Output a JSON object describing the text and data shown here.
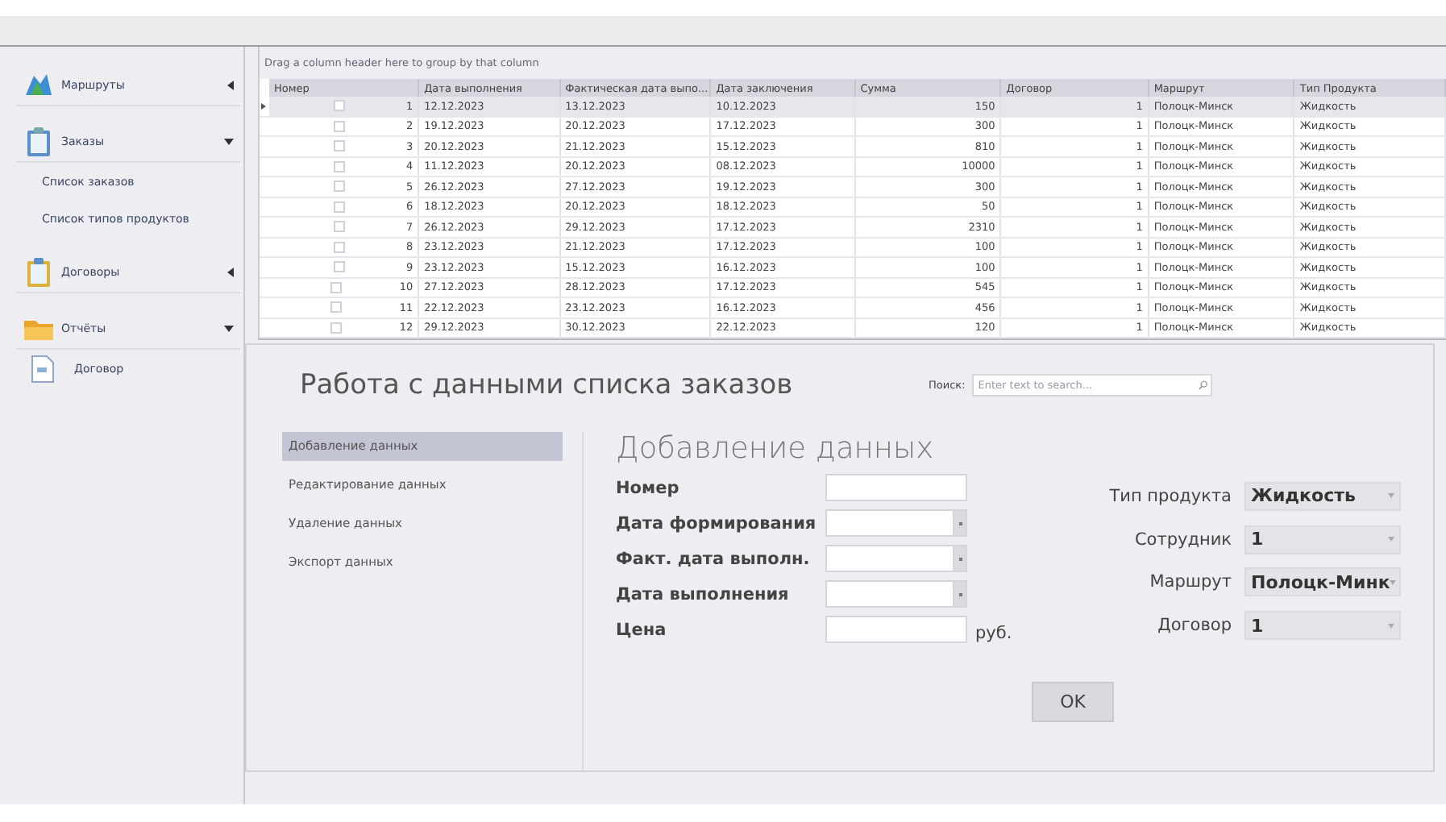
{
  "sidebar": {
    "groups": [
      {
        "label": "Маршруты",
        "expanded": false
      },
      {
        "label": "Заказы",
        "expanded": true,
        "items": [
          {
            "label": "Список заказов"
          },
          {
            "label": "Список типов продуктов"
          }
        ]
      },
      {
        "label": "Договоры",
        "expanded": false
      },
      {
        "label": "Отчёты",
        "expanded": true,
        "items": [
          {
            "label": "Договор"
          }
        ]
      }
    ]
  },
  "grid": {
    "group_hint": "Drag a column header here to group by that column",
    "columns": [
      "Номер",
      "Дата выполнения",
      "Фактическая дата выпо...",
      "Дата заключения",
      "Сумма",
      "Договор",
      "Маршрут",
      "Тип Продукта"
    ],
    "rows": [
      {
        "selected": true,
        "checked": false,
        "cells": [
          "1",
          "12.12.2023",
          "13.12.2023",
          "10.12.2023",
          "150",
          "1",
          "Полоцк-Минск",
          "Жидкость"
        ]
      },
      {
        "selected": false,
        "checked": false,
        "cells": [
          "2",
          "19.12.2023",
          "20.12.2023",
          "17.12.2023",
          "300",
          "1",
          "Полоцк-Минск",
          "Жидкость"
        ]
      },
      {
        "selected": false,
        "checked": false,
        "cells": [
          "3",
          "20.12.2023",
          "21.12.2023",
          "15.12.2023",
          "810",
          "1",
          "Полоцк-Минск",
          "Жидкость"
        ]
      },
      {
        "selected": false,
        "checked": false,
        "cells": [
          "4",
          "11.12.2023",
          "20.12.2023",
          "08.12.2023",
          "10000",
          "1",
          "Полоцк-Минск",
          "Жидкость"
        ]
      },
      {
        "selected": false,
        "checked": false,
        "cells": [
          "5",
          "26.12.2023",
          "27.12.2023",
          "19.12.2023",
          "300",
          "1",
          "Полоцк-Минск",
          "Жидкость"
        ]
      },
      {
        "selected": false,
        "checked": false,
        "cells": [
          "6",
          "18.12.2023",
          "20.12.2023",
          "18.12.2023",
          "50",
          "1",
          "Полоцк-Минск",
          "Жидкость"
        ]
      },
      {
        "selected": false,
        "checked": false,
        "cells": [
          "7",
          "26.12.2023",
          "29.12.2023",
          "17.12.2023",
          "2310",
          "1",
          "Полоцк-Минск",
          "Жидкость"
        ]
      },
      {
        "selected": false,
        "checked": false,
        "cells": [
          "8",
          "23.12.2023",
          "21.12.2023",
          "17.12.2023",
          "100",
          "1",
          "Полоцк-Минск",
          "Жидкость"
        ]
      },
      {
        "selected": false,
        "checked": false,
        "cells": [
          "9",
          "23.12.2023",
          "15.12.2023",
          "16.12.2023",
          "100",
          "1",
          "Полоцк-Минск",
          "Жидкость"
        ]
      },
      {
        "selected": false,
        "checked": false,
        "cells": [
          "10",
          "27.12.2023",
          "28.12.2023",
          "17.12.2023",
          "545",
          "1",
          "Полоцк-Минск",
          "Жидкость"
        ]
      },
      {
        "selected": false,
        "checked": false,
        "cells": [
          "11",
          "22.12.2023",
          "23.12.2023",
          "16.12.2023",
          "456",
          "1",
          "Полоцк-Минск",
          "Жидкость"
        ]
      },
      {
        "selected": false,
        "checked": false,
        "cells": [
          "12",
          "29.12.2023",
          "30.12.2023",
          "22.12.2023",
          "120",
          "1",
          "Полоцк-Минск",
          "Жидкость"
        ]
      }
    ]
  },
  "panel": {
    "title": "Работа с данными списка заказов",
    "search": {
      "label": "Поиск:",
      "placeholder": "Enter text to search..."
    },
    "nav": [
      {
        "label": "Добавление данных",
        "selected": true
      },
      {
        "label": "Редактирование данных",
        "selected": false
      },
      {
        "label": "Удаление данных",
        "selected": false
      },
      {
        "label": "Экспорт данных",
        "selected": false
      }
    ],
    "form": {
      "heading": "Добавление данных",
      "left_fields": [
        {
          "label": "Номер",
          "kind": "text"
        },
        {
          "label": "Дата формирования",
          "kind": "date"
        },
        {
          "label": "Факт. дата выполн.",
          "kind": "date"
        },
        {
          "label": "Дата выполнения",
          "kind": "date"
        },
        {
          "label": "Цена",
          "kind": "text",
          "suffix": "руб."
        }
      ],
      "right_fields": [
        {
          "label": "Тип продукта",
          "value": "Жидкость"
        },
        {
          "label": "Сотрудник",
          "value": "1"
        },
        {
          "label": "Маршрут",
          "value": "Полоцк-Минк"
        },
        {
          "label": "Договор",
          "value": "1"
        }
      ],
      "ok_button": "OK"
    }
  }
}
